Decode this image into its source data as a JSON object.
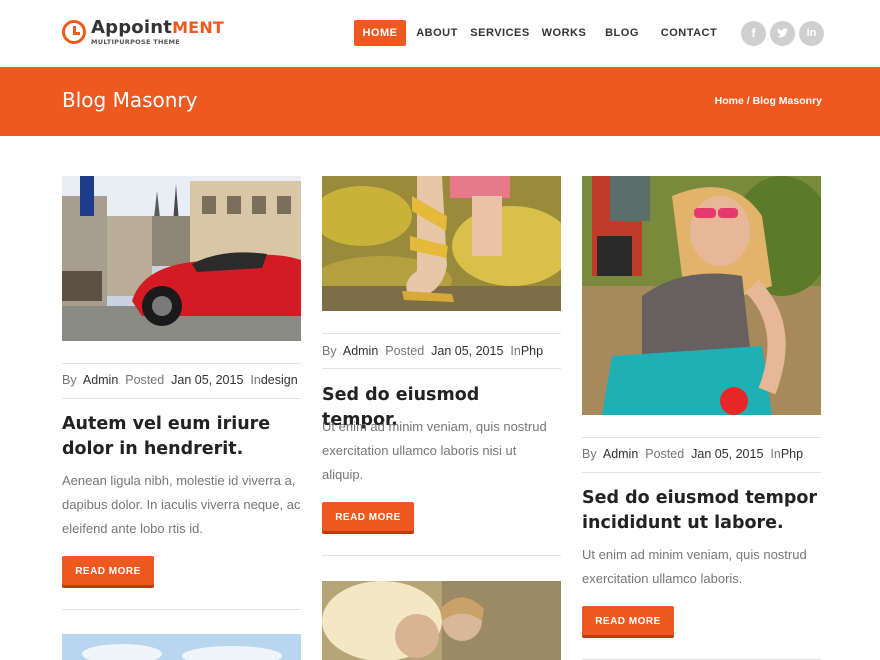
{
  "brand": {
    "name_part1": "Appoint",
    "name_part2": "ment",
    "tagline": "MULTIPURPOSE THEME"
  },
  "nav": {
    "items": [
      {
        "label": "HOME",
        "active": true
      },
      {
        "label": "ABOUT",
        "active": false
      },
      {
        "label": "SERVICES",
        "active": false
      },
      {
        "label": "WORKS",
        "active": false
      },
      {
        "label": "BLOG",
        "active": false
      },
      {
        "label": "CONTACT",
        "active": false
      }
    ]
  },
  "social": [
    {
      "icon": "facebook-icon",
      "glyph": "f"
    },
    {
      "icon": "twitter-icon",
      "glyph": "t"
    },
    {
      "icon": "linkedin-icon",
      "glyph": "in"
    }
  ],
  "page": {
    "title": "Blog Masonry",
    "breadcrumb": "Home / Blog Masonry"
  },
  "meta_labels": {
    "by": "By",
    "posted": "Posted",
    "in": "In"
  },
  "posts": [
    {
      "image": "red-sports-car",
      "author": "Admin",
      "date": "Jan 05, 2015",
      "category": "design",
      "title": "Autem vel eum iriure dolor in hendrerit.",
      "excerpt": "Aenean ligula nibh, molestie id viverra a, dapibus dolor. In iaculis viverra neque, ac eleifend ante lobo rtis id.",
      "button": "READ MORE"
    },
    {
      "image": "sandals-yellow-flowers",
      "author": "Admin",
      "date": "Jan 05, 2015",
      "category": "Php",
      "title": "Sed do eiusmod tempor.",
      "excerpt": "Ut enim ad minim veniam, quis nostrud exercitation ullamco laboris nisi ut aliquip.",
      "button": "READ MORE"
    },
    {
      "image": "girl-sunglasses-playground",
      "author": "Admin",
      "date": "Jan 05, 2015",
      "category": "Php",
      "title": "Sed do eiusmod tempor incididunt ut labore.",
      "excerpt": "Ut enim ad minim veniam, quis nostrud exercitation ullamco laboris.",
      "button": "READ MORE"
    }
  ],
  "colors": {
    "accent": "#ee591f",
    "text_dark": "#222222",
    "text_muted": "#777777"
  }
}
